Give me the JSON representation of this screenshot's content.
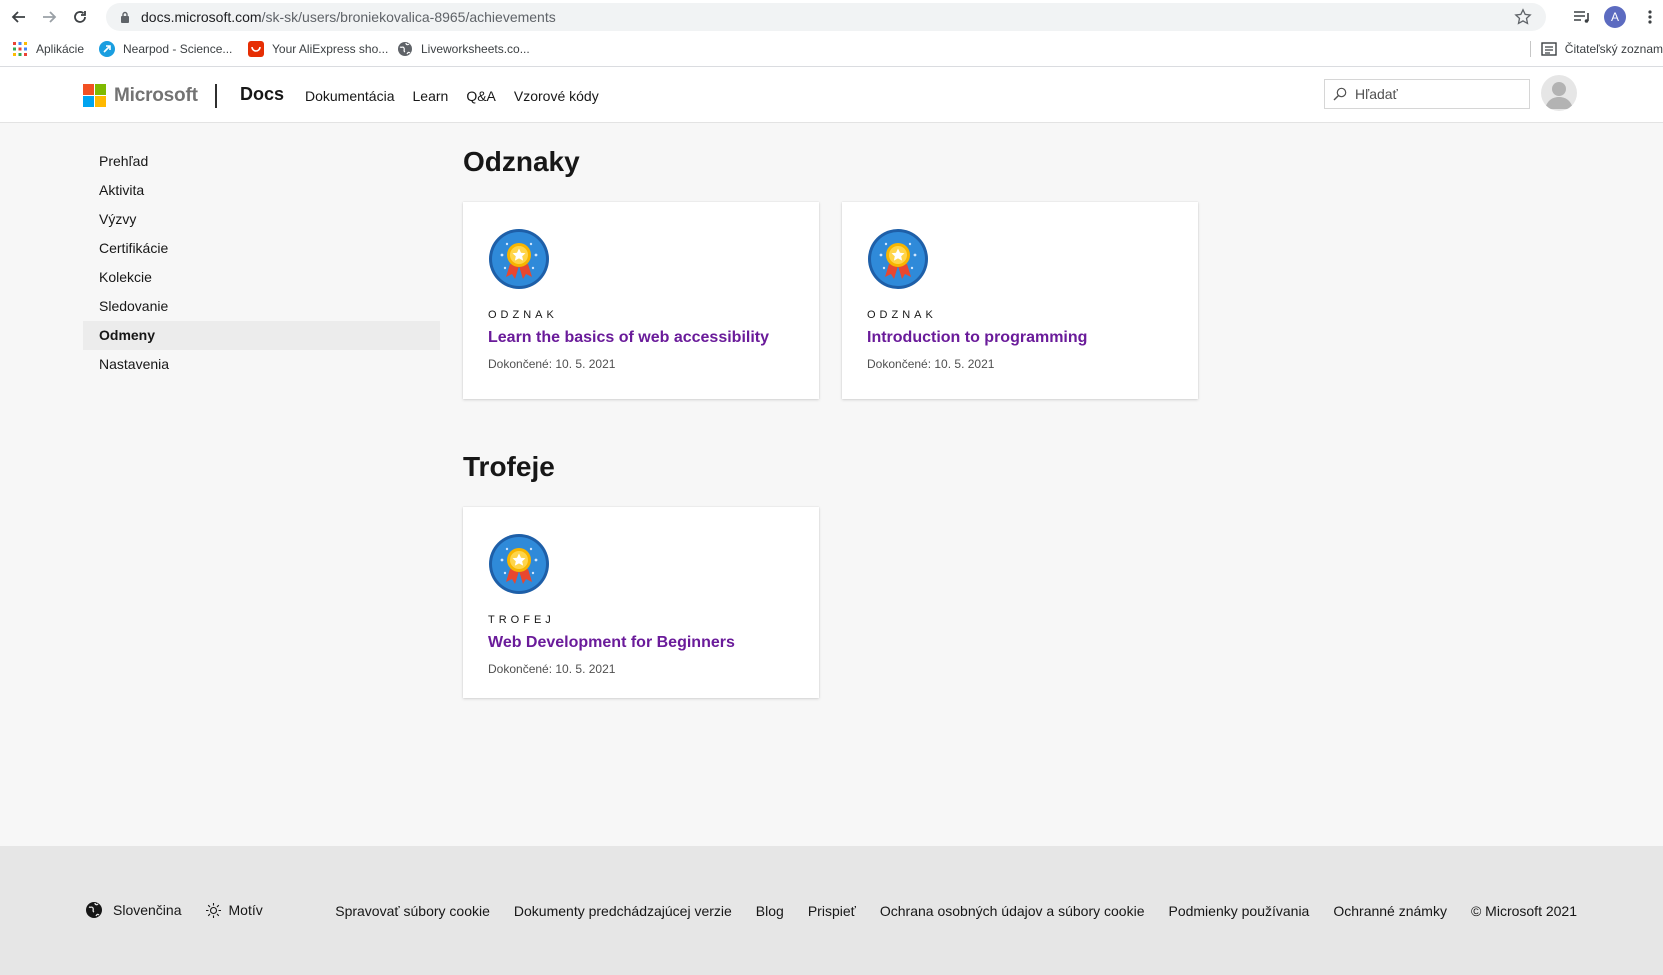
{
  "browser": {
    "url_domain": "docs.microsoft.com",
    "url_path": "/sk-sk/users/broniekovalica-8965/achievements",
    "profile_initial": "A",
    "bookmarks": [
      {
        "label": "Aplikácie",
        "icon": "apps-grid-icon"
      },
      {
        "label": "Nearpod - Science...",
        "icon": "nearpod-icon"
      },
      {
        "label": "Your AliExpress sho...",
        "icon": "aliexpress-icon"
      },
      {
        "label": "Liveworksheets.co...",
        "icon": "globe-icon"
      }
    ],
    "reading_list_label": "Čitateľský zoznam"
  },
  "header": {
    "brand": "Microsoft",
    "site": "Docs",
    "nav": [
      "Dokumentácia",
      "Learn",
      "Q&A",
      "Vzorové kódy"
    ],
    "search_placeholder": "Hľadať"
  },
  "sidebar": {
    "items": [
      "Prehľad",
      "Aktivita",
      "Výzvy",
      "Certifikácie",
      "Kolekcie",
      "Sledovanie",
      "Odmeny",
      "Nastavenia"
    ],
    "active": "Odmeny"
  },
  "main": {
    "badges_heading": "Odznaky",
    "badges": [
      {
        "kind": "ODZNAK",
        "title": "Learn the basics of web accessibility",
        "completed": "Dokončené: 10. 5. 2021"
      },
      {
        "kind": "ODZNAK",
        "title": "Introduction to programming",
        "completed": "Dokončené: 10. 5. 2021"
      }
    ],
    "trophies_heading": "Trofeje",
    "trophies": [
      {
        "kind": "TROFEJ",
        "title": "Web Development for Beginners",
        "completed": "Dokončené: 10. 5. 2021"
      }
    ]
  },
  "footer": {
    "language": "Slovenčina",
    "theme": "Motív",
    "links": [
      "Spravovať súbory cookie",
      "Dokumenty predchádzajúcej verzie",
      "Blog",
      "Prispieť",
      "Ochrana osobných údajov a súbory cookie",
      "Podmienky používania",
      "Ochranné známky",
      "© Microsoft 2021"
    ]
  },
  "colors": {
    "accent_link": "#6a1b9a",
    "ms_red": "#f25022",
    "ms_green": "#7fba00",
    "ms_blue": "#00a4ef",
    "ms_yellow": "#ffb900"
  }
}
